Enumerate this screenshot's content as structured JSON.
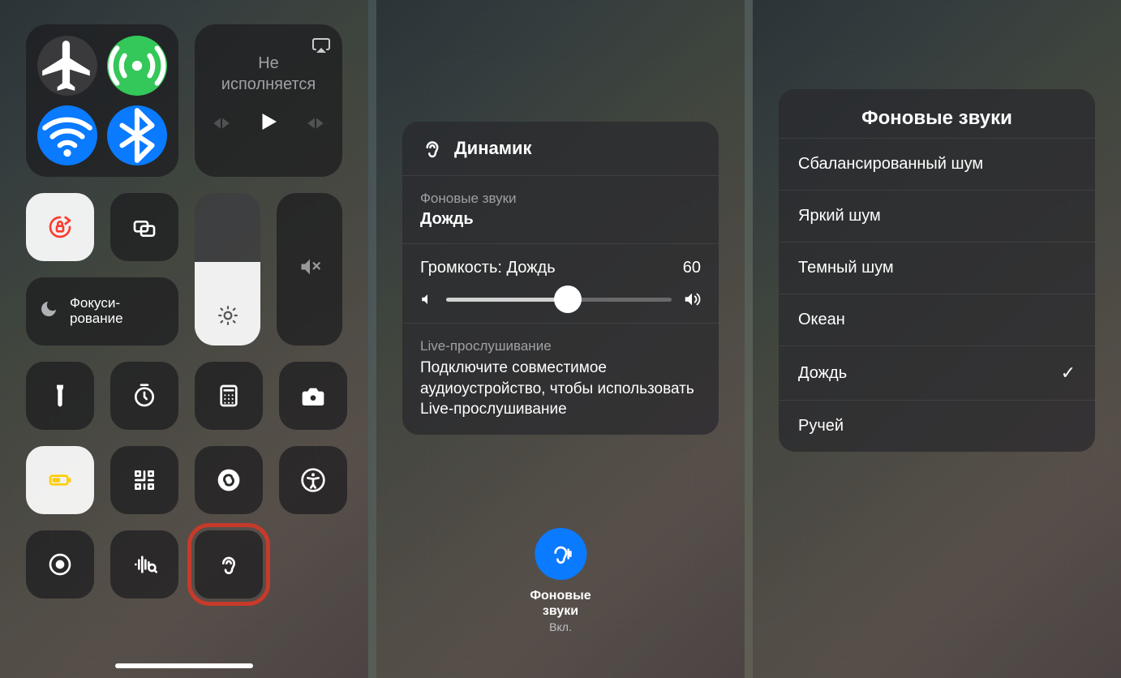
{
  "panel1": {
    "media": {
      "status": "Не\nисполняется"
    },
    "focus_label": "Фокуси-\nрование",
    "brightness_pct": 55
  },
  "panel2": {
    "device": "Динамик",
    "bg_sounds_label": "Фоновые звуки",
    "bg_sound_value": "Дождь",
    "volume_label": "Громкость: Дождь",
    "volume_value": "60",
    "volume_pct": 54,
    "live_title": "Live-прослушивание",
    "live_desc": "Подключите совместимое аудиоустройство, чтобы использовать Live-прослушивание",
    "button_label": "Фоновые\nзвуки",
    "button_state": "Вкл."
  },
  "panel3": {
    "title": "Фоновые звуки",
    "items": [
      {
        "label": "Сбалансированный шум",
        "selected": false
      },
      {
        "label": "Яркий шум",
        "selected": false
      },
      {
        "label": "Темный шум",
        "selected": false
      },
      {
        "label": "Океан",
        "selected": false
      },
      {
        "label": "Дождь",
        "selected": true
      },
      {
        "label": "Ручей",
        "selected": false
      }
    ]
  }
}
